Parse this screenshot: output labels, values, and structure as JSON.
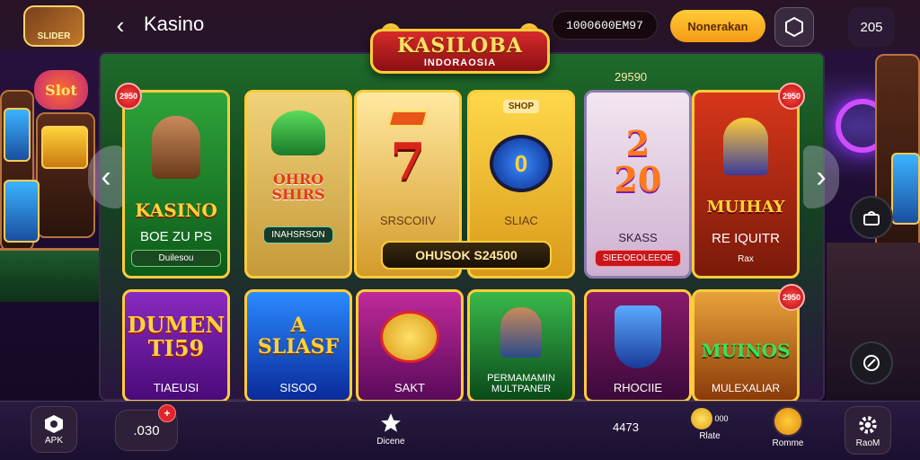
{
  "header": {
    "logo_text": "SLIDER",
    "title": "Kasino",
    "balance": "1000600EM97",
    "cta_label": "Nonerakan",
    "counter": "205"
  },
  "banner": {
    "title": "KASILOBA",
    "subtitle": "INDORAOSIA",
    "jackpot": "29590"
  },
  "background": {
    "left_sign": "Slot"
  },
  "games_row1": [
    {
      "name": "KASINO",
      "sub": "BOE ZU PS",
      "chip": "Duilesou",
      "badge": "2950"
    },
    {
      "name": "OHRO SHIRS",
      "sub": "",
      "chip": "INAHSRSON",
      "badge": ""
    },
    {
      "name": "7",
      "sub": "SRSCOIIV",
      "chip": "",
      "badge": ""
    },
    {
      "name": "0",
      "sub": "SLIAC",
      "chip": "",
      "badge": "",
      "top_label": "SHOP"
    },
    {
      "name": "2 20",
      "sub": "SKASS",
      "chip": "SIEEOEOLEEOE",
      "badge": ""
    },
    {
      "name": "MUIHAY",
      "sub": "RE IQUITR",
      "chip": "Rax",
      "badge": "2950"
    }
  ],
  "wide_bar": "OHUSOK S24500",
  "games_row2": [
    {
      "name": "DUMEN TI59",
      "sub": "TIAEUSI",
      "badge": ""
    },
    {
      "name": "A SLIASF",
      "sub": "SISOO",
      "badge": ""
    },
    {
      "name": "",
      "sub": "SAKT",
      "badge": ""
    },
    {
      "name": "",
      "sub": "PERMAMAMIN MULTPANER",
      "badge": ""
    },
    {
      "name": "",
      "sub": "RHOCIIE",
      "badge": ""
    },
    {
      "name": "MUINOS",
      "sub": "MULEXALIAR",
      "badge": "2950"
    }
  ],
  "bottom": {
    "apk_label": "APK",
    "wallet_value": ".030",
    "wallet_badge": "+",
    "center_label": "Dicene",
    "score": "4473",
    "coins_value": "000",
    "coins_label": "Rlate",
    "chat_label": "Romme",
    "settings_label": "RaoM"
  },
  "colors": {
    "accent_gold": "#ffcc3a",
    "cta_orange": "#f59a12",
    "alert_red": "#e0242a"
  }
}
